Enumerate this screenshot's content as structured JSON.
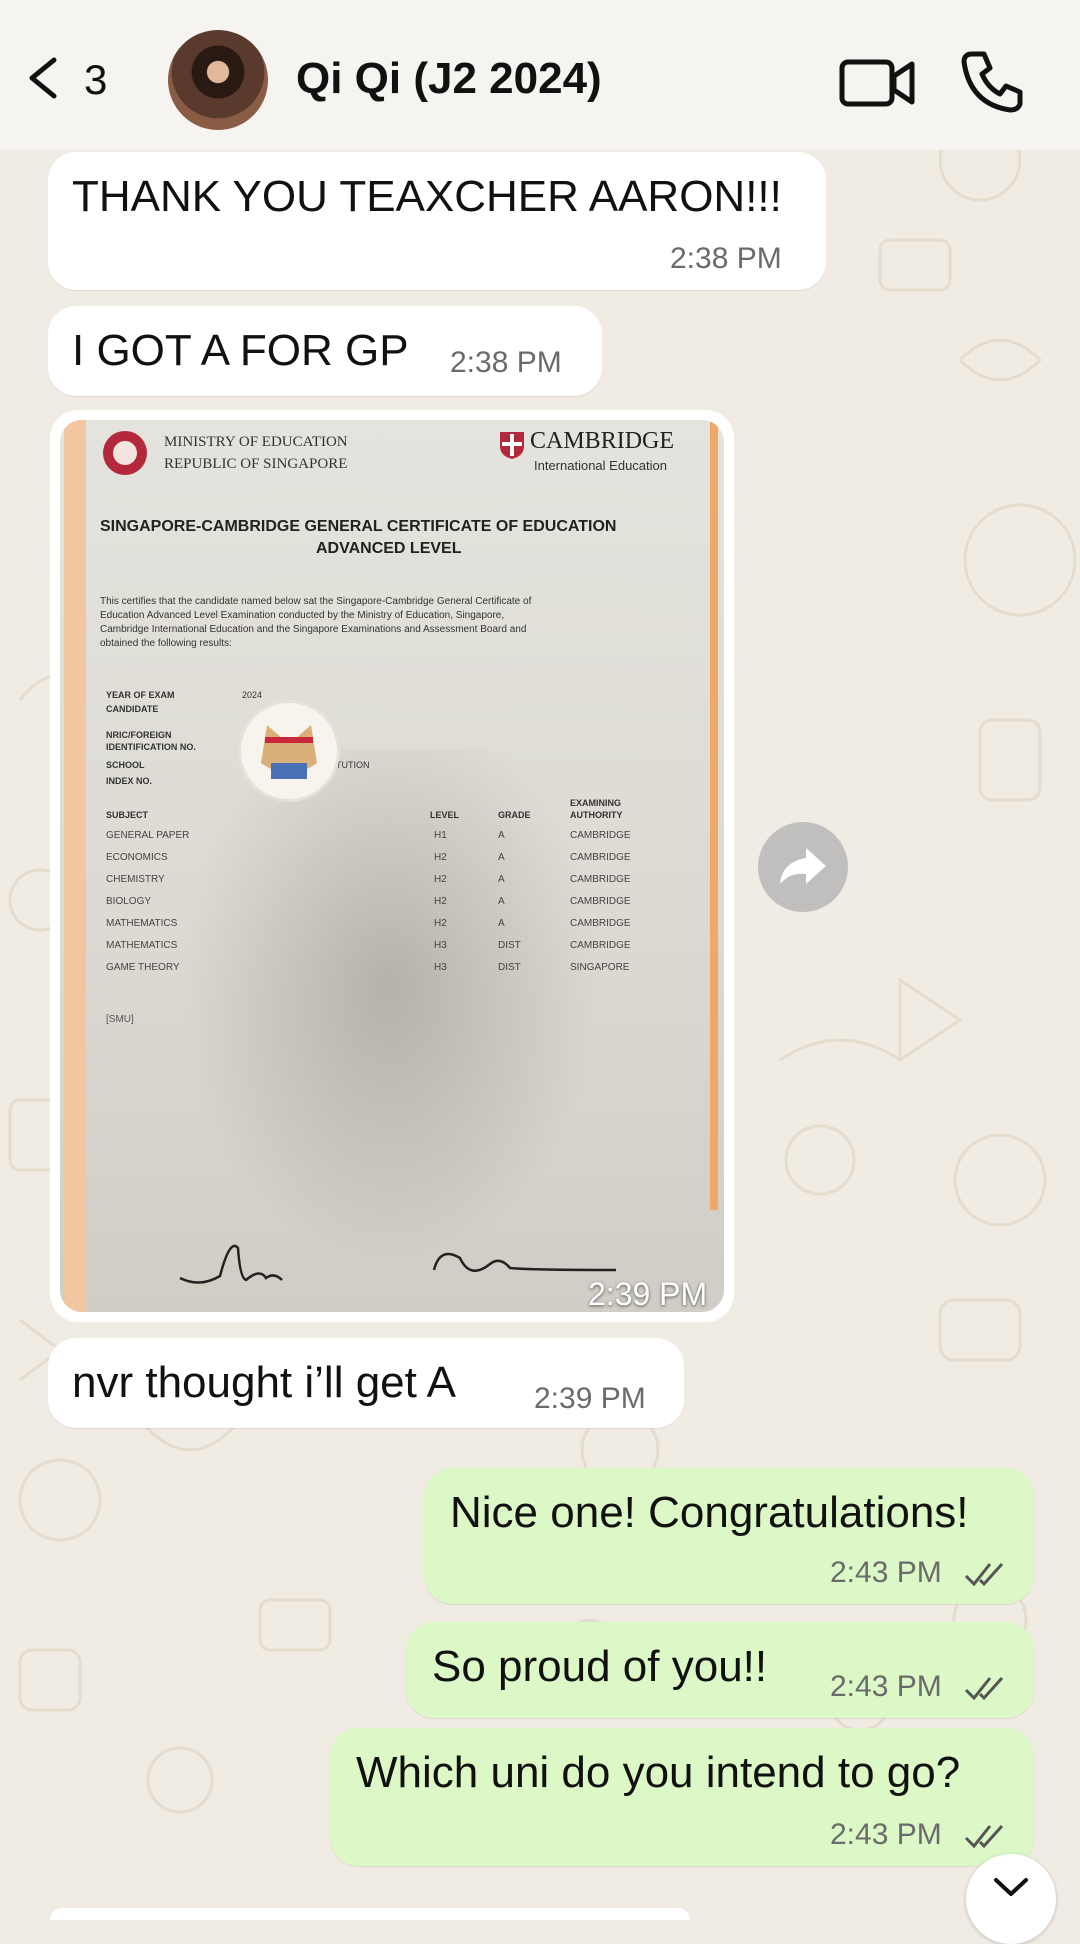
{
  "header": {
    "unread_count": "3",
    "contact_name": "Qi Qi (J2 2024)"
  },
  "messages": [
    {
      "text": "THANK YOU TEAXCHER AARON!!!",
      "time": "2:38 PM"
    },
    {
      "text": "I GOT A FOR GP",
      "time": "2:38 PM"
    },
    {
      "time": "2:39 PM"
    },
    {
      "text": "nvr thought i’ll get A",
      "time": "2:39 PM"
    },
    {
      "text": "Nice one! Congratulations!",
      "time": "2:43 PM"
    },
    {
      "text": "So proud of you!!",
      "time": "2:43 PM"
    },
    {
      "text": "Which uni do you intend to go?",
      "time": "2:43 PM"
    }
  ],
  "certificate": {
    "moe_line1": "MINISTRY OF EDUCATION",
    "moe_line2": "REPUBLIC OF SINGAPORE",
    "cambridge_line1": "CAMBRIDGE",
    "cambridge_line2": "International Education",
    "title_line1": "SINGAPORE-CAMBRIDGE GENERAL CERTIFICATE OF EDUCATION",
    "title_line2": "ADVANCED LEVEL",
    "body_lines": [
      "This certifies that the candidate named below sat the Singapore-Cambridge General Certificate of",
      "Education Advanced Level Examination conducted by the Ministry of Education, Singapore,",
      "Cambridge International Education and the Singapore Examinations and Assessment Board and",
      "obtained the following results:"
    ],
    "fields": {
      "year_label": "YEAR OF EXAM",
      "year_value": "2024",
      "candidate_label": "CANDIDATE",
      "nric_label_1": "NRIC/FOREIGN",
      "nric_label_2": "IDENTIFICATION NO.",
      "school_label": "SCHOOL",
      "school_partial": "STITUTION",
      "index_label": "INDEX NO."
    },
    "table_headers": {
      "subject": "SUBJECT",
      "level": "LEVEL",
      "grade": "GRADE",
      "authority_1": "EXAMINING",
      "authority_2": "AUTHORITY"
    },
    "results": [
      {
        "subject": "GENERAL PAPER",
        "level": "H1",
        "grade": "A",
        "authority": "CAMBRIDGE"
      },
      {
        "subject": "ECONOMICS",
        "level": "H2",
        "grade": "A",
        "authority": "CAMBRIDGE"
      },
      {
        "subject": "CHEMISTRY",
        "level": "H2",
        "grade": "A",
        "authority": "CAMBRIDGE"
      },
      {
        "subject": "BIOLOGY",
        "level": "H2",
        "grade": "A",
        "authority": "CAMBRIDGE"
      },
      {
        "subject": "MATHEMATICS",
        "level": "H2",
        "grade": "A",
        "authority": "CAMBRIDGE"
      },
      {
        "subject": "MATHEMATICS",
        "level": "H3",
        "grade": "DIST",
        "authority": "CAMBRIDGE"
      },
      {
        "subject": "GAME THEORY",
        "level": "H3",
        "grade": "DIST",
        "authority": "SINGAPORE"
      }
    ],
    "smu_note": "[SMU]"
  },
  "icons": {
    "back": "chevron-left-icon",
    "video": "video-camera-icon",
    "call": "phone-icon",
    "forward": "forward-arrow-icon",
    "scroll": "chevron-down-icon",
    "read": "double-check-icon"
  },
  "colors": {
    "incoming_bubble": "#ffffff",
    "outgoing_bubble": "#dcf8c6",
    "chat_background": "#f0ebe3",
    "header_background": "#f6f4f0"
  }
}
